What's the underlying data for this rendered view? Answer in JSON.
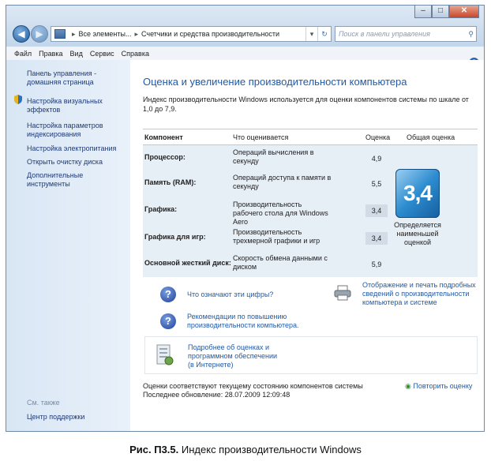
{
  "address": {
    "crumb1": "Все элементы...",
    "crumb2": "Счетчики и средства производительности"
  },
  "search": {
    "placeholder": "Поиск в панели управления"
  },
  "menu": [
    "Файл",
    "Правка",
    "Вид",
    "Сервис",
    "Справка"
  ],
  "sidebar": {
    "items": [
      "Панель управления - домашняя страница",
      "Настройка визуальных эффектов",
      "Настройка параметров индексирования",
      "Настройка электропитания",
      "Открыть очистку диска",
      "Дополнительные инструменты"
    ],
    "see_also": "См. также",
    "support": "Центр поддержки"
  },
  "main": {
    "title": "Оценка и увеличение производительности компьютера",
    "intro": "Индекс производительности Windows используется для оценки компонентов системы по шкале от 1,0 до 7,9.",
    "headers": {
      "component": "Компонент",
      "what": "Что оценивается",
      "score": "Оценка",
      "overall": "Общая оценка"
    },
    "rows": [
      {
        "component": "Процессор:",
        "what": "Операций вычисления в секунду",
        "score": "4,9"
      },
      {
        "component": "Память (RAM):",
        "what": "Операций доступа к памяти в секунду",
        "score": "5,5"
      },
      {
        "component": "Графика:",
        "what": "Производительность рабочего стола для Windows Aero",
        "score": "3,4"
      },
      {
        "component": "Графика для игр:",
        "what": "Производительность трехмерной графики и игр",
        "score": "3,4"
      },
      {
        "component": "Основной жесткий диск:",
        "what": "Скорость обмена данными с диском",
        "score": "5,9"
      }
    ],
    "overall_score": "3,4",
    "overall_desc": "Определяется наименьшей оценкой",
    "link_numbers": "Что означают эти цифры?",
    "link_print": "Отображение и печать подробных сведений о производительности компьютера и системе",
    "link_tips": "Рекомендации по повышению производительности компьютера.",
    "link_more": "Подробнее об оценках и программном обеспечении (в Интернете)",
    "footer_line1": "Оценки соответствуют текущему состоянию компонентов системы",
    "footer_line2": "Последнее обновление: 28.07.2009 12:09:48",
    "rerun": "Повторить оценку"
  },
  "caption": {
    "label": "Рис. П3.5.",
    "text": "Индекс производительности Windows"
  }
}
